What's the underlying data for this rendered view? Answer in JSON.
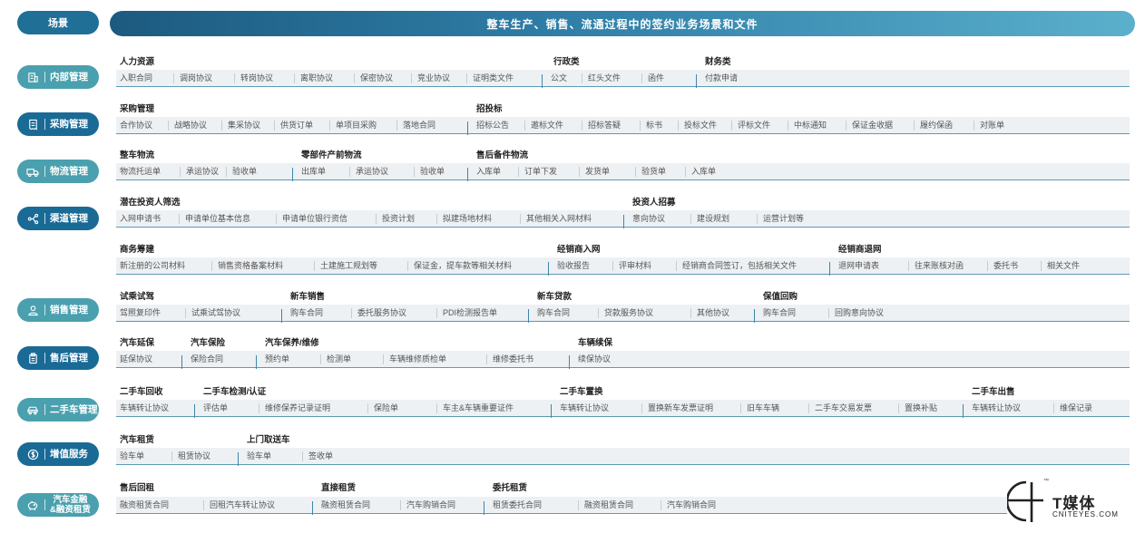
{
  "header": {
    "left_label": "场景",
    "title": "整车生产、销售、流通过程中的签约业务场景和文件"
  },
  "colors": {
    "header_dark": "#1f6f97",
    "pill_dark": "#1a6a96",
    "pill_teal": "#4aa0ae",
    "band_bg": "#edf1f4",
    "band_line": "#5c9ab6"
  },
  "rows": [
    {
      "pill": {
        "label": "内部管理",
        "icon": "building-icon"
      },
      "groups": [
        {
          "title": "人力资源",
          "items": [
            "入职合同",
            "调岗协议",
            "转岗协议",
            "离职协议",
            "保密协议",
            "竞业协议",
            "证明类文件"
          ]
        },
        {
          "title": "行政类",
          "items": [
            "公文",
            "红头文件",
            "函件"
          ]
        },
        {
          "title": "财务类",
          "items": [
            "付款申请"
          ]
        }
      ]
    },
    {
      "pill": {
        "label": "采购管理",
        "icon": "receipt-icon"
      },
      "groups": [
        {
          "title": "采购管理",
          "items": [
            "合作协议",
            "战略协议",
            "集采协议",
            "供货订单",
            "单项目采购",
            "落地合同"
          ]
        },
        {
          "title": "招投标",
          "items": [
            "招标公告",
            "邀标文件",
            "招标答疑",
            "标书",
            "投标文件",
            "评标文件",
            "中标通知",
            "保证金收据",
            "履约保函",
            "对账单"
          ]
        }
      ]
    },
    {
      "pill": {
        "label": "物流管理",
        "icon": "truck-icon"
      },
      "groups": [
        {
          "title": "整车物流",
          "items": [
            "物流托运单",
            "承运协议",
            "验收单"
          ]
        },
        {
          "title": "零部件产前物流",
          "items": [
            "出库单",
            "承运协议",
            "验收单"
          ]
        },
        {
          "title": "售后备件物流",
          "items": [
            "入库单",
            "订单下发",
            "发货单",
            "验货单",
            "入库单"
          ]
        }
      ]
    },
    {
      "pill": {
        "label": "渠道管理",
        "icon": "branch-icon"
      },
      "groups": [
        {
          "title": "潜在投资人筛选",
          "items": [
            "入网申请书",
            "申请单位基本信息",
            "申请单位银行资信",
            "投资计划",
            "拟建场地材料",
            "其他相关入网材料"
          ]
        },
        {
          "title": "投资人招募",
          "items": [
            "意向协议",
            "建设规划",
            "运营计划等"
          ]
        }
      ]
    },
    {
      "pill": null,
      "groups": [
        {
          "title": "商务筹建",
          "items": [
            "新注册的公司材料",
            "销售资格备案材料",
            "土建施工规划等",
            "保证金，提车款等相关材料"
          ]
        },
        {
          "title": "经销商入网",
          "items": [
            "验收报告",
            "评审材料",
            "经销商合同签订，包括相关文件"
          ]
        },
        {
          "title": "经销商退网",
          "items": [
            "退网申请表",
            "往来账核对函",
            "委托书",
            "相关文件"
          ]
        }
      ]
    },
    {
      "pill": {
        "label": "销售管理",
        "icon": "person-icon"
      },
      "groups": [
        {
          "title": "试乘试驾",
          "items": [
            "驾照复印件",
            "试乘试驾协议"
          ]
        },
        {
          "title": "新车销售",
          "items": [
            "购车合同",
            "委托服务协议",
            "PDI检测报告单"
          ]
        },
        {
          "title": "新车贷款",
          "items": [
            "购车合同",
            "贷款服务协议",
            "其他协议"
          ]
        },
        {
          "title": "保值回购",
          "items": [
            "购车合同",
            "回购意向协议"
          ]
        }
      ]
    },
    {
      "pill": {
        "label": "售后管理",
        "icon": "clipboard-icon"
      },
      "groups": [
        {
          "title": "汽车延保",
          "items": [
            "延保协议"
          ]
        },
        {
          "title": "汽车保险",
          "items": [
            "保险合同"
          ]
        },
        {
          "title": "汽车保养/维修",
          "items": [
            "预约单",
            "检测单",
            "车辆维修质检单",
            "维修委托书"
          ]
        },
        {
          "title": "车辆续保",
          "items": [
            "续保协议"
          ]
        }
      ]
    },
    {
      "pill": {
        "label": "二手车管理",
        "icon": "car-icon"
      },
      "groups": [
        {
          "title": "二手车回收",
          "items": [
            "车辆转让协议"
          ]
        },
        {
          "title": "二手车检测/认证",
          "items": [
            "评估单",
            "维修保养记录证明",
            "保险单",
            "车主&车辆重要证件"
          ]
        },
        {
          "title": "二手车置换",
          "items": [
            "车辆转让协议",
            "置换新车发票证明",
            "旧车车辆",
            "二手车交易发票",
            "置换补贴"
          ]
        },
        {
          "title": "二手车出售",
          "items": [
            "车辆转让协议",
            "维保记录"
          ]
        }
      ]
    },
    {
      "pill": {
        "label": "增值服务",
        "icon": "coin-icon"
      },
      "groups": [
        {
          "title": "汽车租赁",
          "items": [
            "验车单",
            "租赁协议"
          ]
        },
        {
          "title": "上门取送车",
          "items": [
            "验车单",
            "签收单"
          ]
        }
      ]
    },
    {
      "pill": {
        "label": "汽车金融\n&融资租赁",
        "icon": "piggy-icon"
      },
      "groups": [
        {
          "title": "售后回租",
          "items": [
            "融资租赁合同",
            "回租汽车转让协议"
          ]
        },
        {
          "title": "直接租赁",
          "items": [
            "融资租赁合同",
            "汽车购销合同"
          ]
        },
        {
          "title": "委托租赁",
          "items": [
            "租赁委托合同",
            "融资租赁合同",
            "汽车购销合同"
          ]
        }
      ]
    }
  ],
  "logo": {
    "tm": "™",
    "name": "T媒体",
    "domain": "CNITEYES.COM"
  }
}
